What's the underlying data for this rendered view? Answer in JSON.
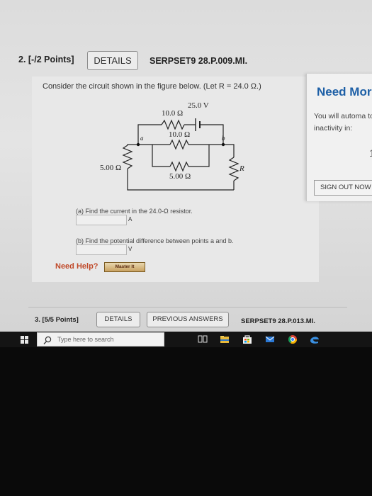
{
  "question2": {
    "header": "2. [-/2 Points]",
    "details_label": "DETAILS",
    "code": "SERPSET9 28.P.009.MI.",
    "prompt": "Consider the circuit shown in the figure below. (Let R = 24.0 Ω.)",
    "circuit": {
      "battery_label": "25.0 V",
      "r_top_left": "10.0 Ω",
      "r_middle_top": "10.0 Ω",
      "r_middle_bottom": "5.00 Ω",
      "r_left": "5.00 Ω",
      "r_right": "R",
      "node_a": "a",
      "node_b": "b"
    },
    "part_a": {
      "text": "(a) Find the current in the 24.0-Ω resistor.",
      "value": "",
      "unit": "A"
    },
    "part_b": {
      "text": "(b) Find the potential difference between points a and b.",
      "value": "",
      "unit": "V"
    },
    "need_help_label": "Need Help?",
    "master_it_label": "Master It"
  },
  "side_panel": {
    "title": "Need Mor",
    "message": "You will automa to inactivity in:",
    "countdown": "1",
    "sign_out_label": "SIGN OUT NOW"
  },
  "question3": {
    "header": "3. [5/5 Points]",
    "details_label": "DETAILS",
    "previous_answers_label": "PREVIOUS ANSWERS",
    "code": "SERPSET9 28.P.013.MI."
  },
  "taskbar": {
    "search_placeholder": "Type here to search",
    "icons": [
      "windows-start-icon",
      "search-icon",
      "task-view-icon",
      "file-explorer-icon",
      "store-icon",
      "mail-icon",
      "chrome-icon",
      "edge-icon"
    ]
  },
  "colors": {
    "accent_blue": "#1d5fa6",
    "need_help": "#c04a2a",
    "taskbar": "#141414"
  }
}
